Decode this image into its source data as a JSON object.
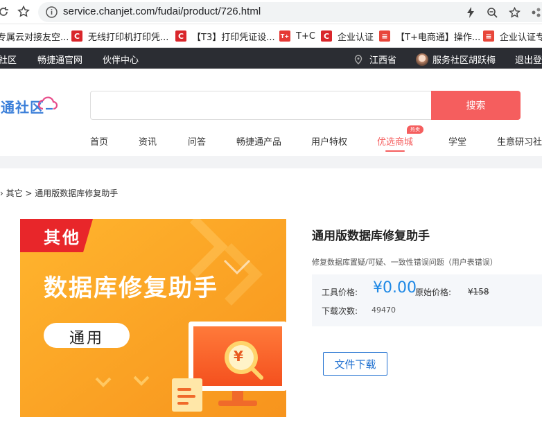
{
  "browser": {
    "url": "service.chanjet.com/fudai/product/726.html"
  },
  "bookmarks": [
    {
      "label": "专属云对接友空...",
      "color": "#ffffff"
    },
    {
      "label": "无线打印机打印凭...",
      "color": "#d9262b"
    },
    {
      "label": "【T3】打印凭证设...",
      "color": "#d9262b"
    },
    {
      "label": "T+C",
      "color": "#e53935"
    },
    {
      "label": "企业认证",
      "color": "#d9262b"
    },
    {
      "label": "【T+电商通】操作...",
      "color": "#e8463a"
    },
    {
      "label": "企业认证专",
      "color": "#e8463a"
    }
  ],
  "topnav": {
    "left": [
      "社区",
      "畅捷通官网",
      "伙伴中心"
    ],
    "location": "江西省",
    "user": "服务社区胡跃梅",
    "logout": "退出登录"
  },
  "header": {
    "logo_text": "捷通社区",
    "search_button": "搜索",
    "search_placeholder": "",
    "menu": [
      "首页",
      "资讯",
      "问答",
      "畅捷通产品",
      "用户特权",
      "优选商城",
      "学堂",
      "生意研习社"
    ],
    "active_menu": "优选商城",
    "hot_badge": "热卖"
  },
  "breadcrumb": "› 其它 > 通用版数据库修复助手",
  "product": {
    "image": {
      "tag": "其他",
      "headline": "数据库修复助手",
      "pill": "通用"
    },
    "title": "通用版数据库修复助手",
    "description": "修复数据库置疑/可疑、一致性错误问题（用户表错误）",
    "tool_price_label": "工具价格:",
    "tool_price": "¥0.00",
    "original_price_label": "原始价格:",
    "original_price": "¥158",
    "download_count_label": "下载次数:",
    "download_count": "49470",
    "download_button": "文件下载"
  },
  "colors": {
    "accent_red": "#f55e5e",
    "price_blue": "#1e88e5",
    "nav_dark": "#2b2d33"
  }
}
